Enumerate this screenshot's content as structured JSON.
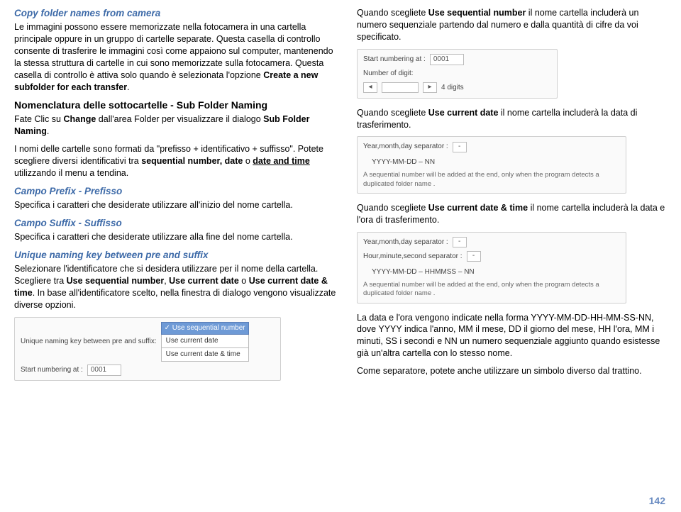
{
  "left": {
    "h1": "Copy folder names from camera",
    "p1": "Le immagini possono essere memorizzate nella fotocamera in una cartella principale oppure in un gruppo di cartelle separate. Questa casella di controllo consente di trasferire le immagini così come appaiono sul computer, mantenendo la stessa struttura di cartelle in cui sono memorizzate sulla fotocamera. Questa casella di controllo è attiva solo quando è selezionata l'opzione ",
    "p1b": "Create a new subfolder for each transfer",
    "p1end": ".",
    "h2": "Nomenclatura delle sottocartelle - Sub Folder Naming",
    "p2a": "Fate Clic su ",
    "p2b": "Change",
    "p2c": " dall'area Folder per visualizzare il dialogo ",
    "p2d": "Sub Folder Naming",
    "p2e": ".",
    "p3a": "I nomi delle cartelle sono formati da \"prefisso + identificativo + suffisso\". Potete scegliere diversi identificativi tra ",
    "p3b": "sequential number, date",
    "p3c": " o ",
    "p3d": "date and time",
    "p3e": " utilizzando il menu a tendina.",
    "h3": "Campo Prefix - Prefisso",
    "p4": "Specifica i caratteri che desiderate utilizzare all'inizio del nome cartella.",
    "h4": "Campo Suffix - Suffisso",
    "p5": "Specifica i caratteri che desiderate utilizzare alla fine del nome cartella.",
    "h5": "Unique naming key between pre and suffix",
    "p6a": "Selezionare l'identificatore che si desidera utilizzare per il nome della cartella. Scegliere tra ",
    "p6b": "Use sequential number",
    "p6c": ", ",
    "p6d": "Use current date",
    "p6e": " o ",
    "p6f": "Use current date & time",
    "p6g": ". In base all'identificatore scelto, nella finestra di dialogo vengono visualizzate diverse opzioni.",
    "panel1": {
      "row1a": "Unique naming key between pre and suffix:",
      "dd_sel": "✓ Use sequential number",
      "dd_o1": "Use current date",
      "dd_o2": "Use current date & time",
      "row2a": "Start numbering at :",
      "row2b": "0001"
    }
  },
  "right": {
    "p1a": "Quando scegliete ",
    "p1b": "Use sequential number",
    "p1c": " il nome cartella includerà un numero sequenziale partendo dal numero e dalla quantità di cifre da voi specificato.",
    "panel2": {
      "r1a": "Start numbering at :",
      "r1b": "0001",
      "r2a": "Number of digit:",
      "r2b": "4 digits"
    },
    "p2a": "Quando scegliete ",
    "p2b": "Use current date",
    "p2c": " il nome cartella includerà la data di trasferimento.",
    "panel3": {
      "r1a": "Year,month,day separator :",
      "r1b": "-",
      "r2a": "YYYY-MM-DD – NN",
      "note": "A sequential number will be added at the end, only when the program detects a duplicated folder name ."
    },
    "p3a": "Quando scegliete ",
    "p3b": "Use current date & time",
    "p3c": " il nome cartella includerà la data e l'ora di trasferimento.",
    "panel4": {
      "r1a": "Year,month,day separator :",
      "r1b": "-",
      "r2a": "Hour,minute,second separator :",
      "r2b": "-",
      "r3a": "YYYY-MM-DD – HHMMSS – NN",
      "note": "A sequential number will be added at the end, only when the program detects a duplicated folder name ."
    },
    "p4": "La data e l'ora vengono indicate nella forma YYYY-MM-DD-HH-MM-SS-NN, dove YYYY indica l'anno, MM il mese, DD il giorno del mese, HH l'ora, MM i minuti, SS i secondi e NN un numero sequenziale aggiunto quando esistesse già un'altra cartella con lo stesso nome.",
    "p5": "Come separatore, potete anche utilizzare un simbolo diverso dal trattino."
  },
  "page_number": "142"
}
